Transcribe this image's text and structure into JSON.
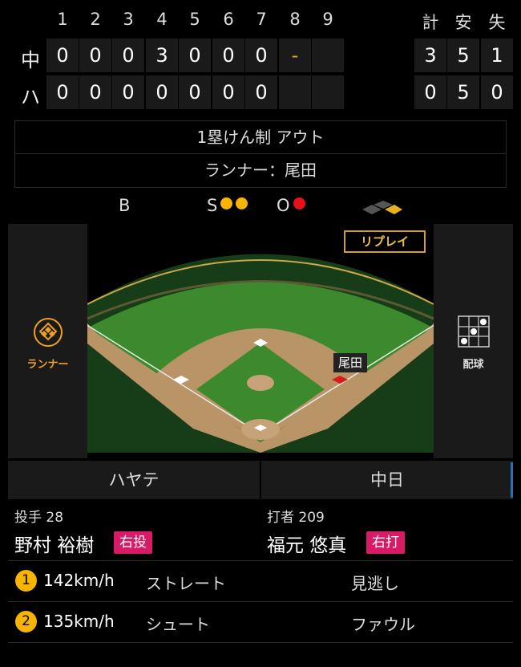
{
  "scoreboard": {
    "innings": [
      "1",
      "2",
      "3",
      "4",
      "5",
      "6",
      "7",
      "8",
      "9"
    ],
    "totals_headers": [
      "計",
      "安",
      "失"
    ],
    "away": {
      "label": "中",
      "scores": [
        "0",
        "0",
        "0",
        "3",
        "0",
        "0",
        "0",
        "-",
        ""
      ],
      "totals": [
        "3",
        "5",
        "1"
      ]
    },
    "home": {
      "label": "ハ",
      "scores": [
        "0",
        "0",
        "0",
        "0",
        "0",
        "0",
        "0",
        "",
        ""
      ],
      "totals": [
        "0",
        "5",
        "0"
      ]
    }
  },
  "situation": {
    "play": "1塁けん制 アウト",
    "runner": "ランナー：尾田"
  },
  "count": {
    "b_label": "B",
    "s_label": "S",
    "o_label": "O",
    "balls": 0,
    "strikes": 2,
    "outs": 1
  },
  "field": {
    "replay_label": "リプレイ",
    "runner_name": "尾田",
    "left_label": "ランナー",
    "right_label": "配球"
  },
  "teams": {
    "left": "ハヤテ",
    "right": "中日"
  },
  "pitcher": {
    "role": "投手",
    "number": "28",
    "name": "野村 裕樹",
    "hand": "右投"
  },
  "batter": {
    "role": "打者",
    "number": "209",
    "name": "福元 悠真",
    "hand": "右打"
  },
  "pitches": [
    {
      "num": "1",
      "speed": "142km/h",
      "type": "ストレート",
      "result": "見逃し"
    },
    {
      "num": "2",
      "speed": "135km/h",
      "type": "シュート",
      "result": "ファウル"
    }
  ],
  "colors": {
    "accent_yellow": "#f7b500",
    "out_red": "#e8101a",
    "hand_badge": "#d81b66",
    "active_tab": "#2a6fb8"
  }
}
